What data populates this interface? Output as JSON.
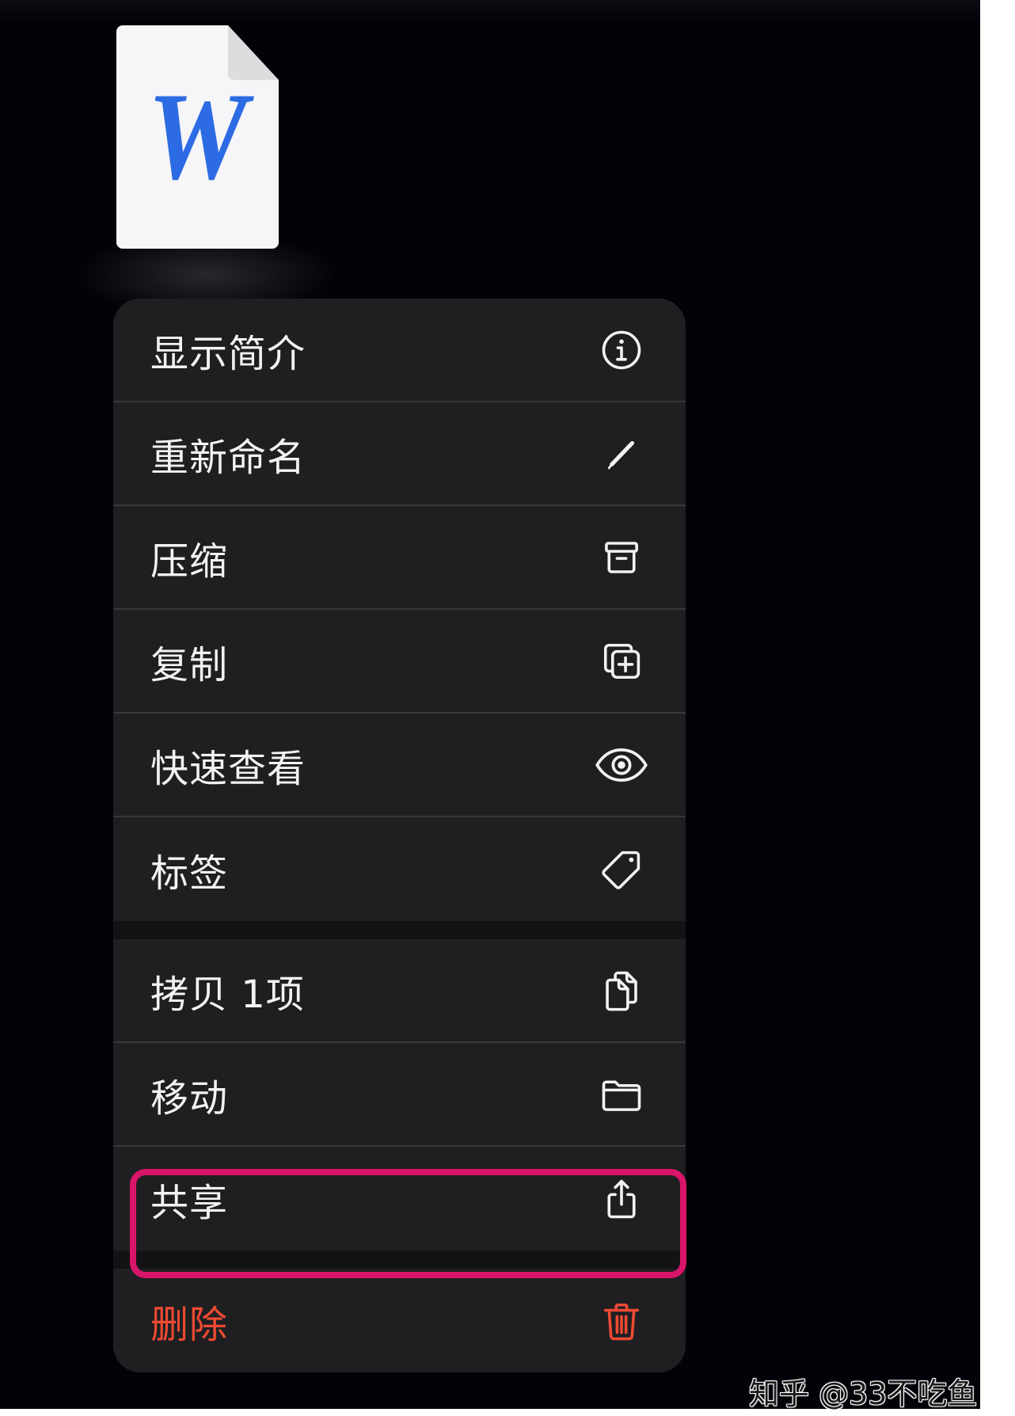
{
  "document": {
    "icon": "word-document-icon",
    "letter": "W"
  },
  "menu": {
    "groups": [
      {
        "items": [
          {
            "label": "显示简介",
            "icon": "info-icon"
          },
          {
            "label": "重新命名",
            "icon": "pencil-icon"
          },
          {
            "label": "压缩",
            "icon": "archive-box-icon"
          },
          {
            "label": "复制",
            "icon": "duplicate-icon"
          },
          {
            "label": "快速查看",
            "icon": "eye-icon"
          },
          {
            "label": "标签",
            "icon": "tag-icon"
          }
        ]
      },
      {
        "items": [
          {
            "label": "拷贝 1项",
            "icon": "copy-documents-icon"
          },
          {
            "label": "移动",
            "icon": "folder-icon"
          },
          {
            "label": "共享",
            "icon": "share-icon",
            "highlighted": true
          }
        ]
      },
      {
        "items": [
          {
            "label": "删除",
            "icon": "trash-icon",
            "destructive": true
          }
        ]
      }
    ]
  },
  "watermark": "知乎 @33不吃鱼",
  "colors": {
    "screen_bg": "#030208",
    "menu_bg": "#1f1f21",
    "separator": "#38383a",
    "group_gap": "#131315",
    "text": "#f2f2f4",
    "destructive": "#ef4a33",
    "highlight": "#d8156a",
    "word_blue": "#2c6be3",
    "document_page": "#f6f6f8",
    "document_fold": "#dddde0",
    "watermark_text": "#1c1c1c"
  }
}
